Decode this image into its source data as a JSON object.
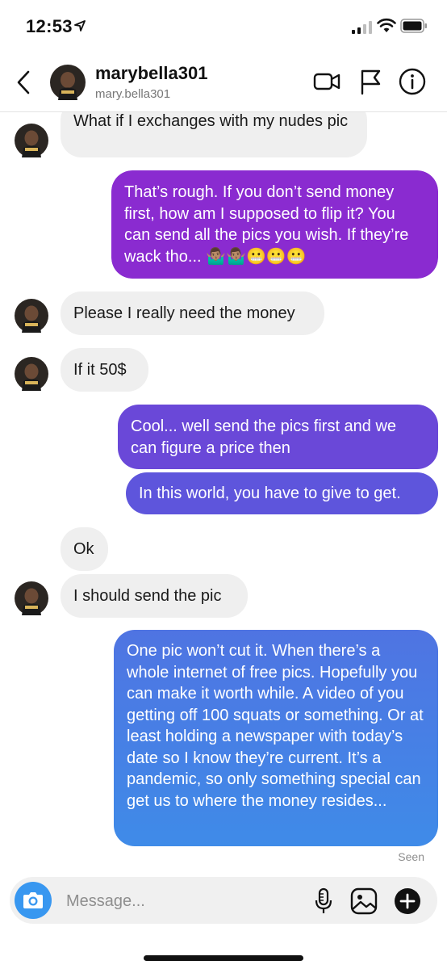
{
  "status": {
    "time": "12:53"
  },
  "header": {
    "username": "marybella301",
    "handle": "mary.bella301"
  },
  "messages": [
    {
      "from": "them",
      "text": "What  if I exchanges with my nudes pic"
    },
    {
      "from": "me",
      "text": "That’s rough. If you don’t send money first, how am I supposed to flip it? You can send all the pics you wish. If they’re wack tho... 🤷🏽‍♂️🤷🏽‍♂️😬😬😬"
    },
    {
      "from": "them",
      "text": "Please I really need the money"
    },
    {
      "from": "them",
      "text": "If it 50$"
    },
    {
      "from": "me",
      "text": "Cool... well send the pics first and we can figure a price then"
    },
    {
      "from": "me",
      "text": "In this world, you have to give to get."
    },
    {
      "from": "them",
      "text": "Ok"
    },
    {
      "from": "them",
      "text": "I should send the pic"
    },
    {
      "from": "me",
      "text": "One pic won’t cut it. When there’s a whole internet of free pics. Hopefully you can make it worth while. A video of you getting off 100 squats or something. Or at least holding a newspaper with today’s date so I know they’re current. It’s a pandemic, so only something special can get us to where the money resides..."
    }
  ],
  "seen": "Seen",
  "composer": {
    "placeholder": "Message..."
  },
  "icons": {
    "back": "chevron-left-icon",
    "video": "video-camera-icon",
    "flag": "flag-icon",
    "info": "info-icon",
    "camera": "camera-icon",
    "mic": "microphone-icon",
    "gallery": "gallery-icon",
    "add": "plus-circle-icon"
  },
  "colors": {
    "incoming_bubble": "#efefef",
    "gradient_top": "#8a2bd0",
    "gradient_mid": "#6a4ad8",
    "gradient_bottom": "#3f8be8",
    "camera_button": "#3897f0",
    "seen_text": "#8e8e8e"
  }
}
